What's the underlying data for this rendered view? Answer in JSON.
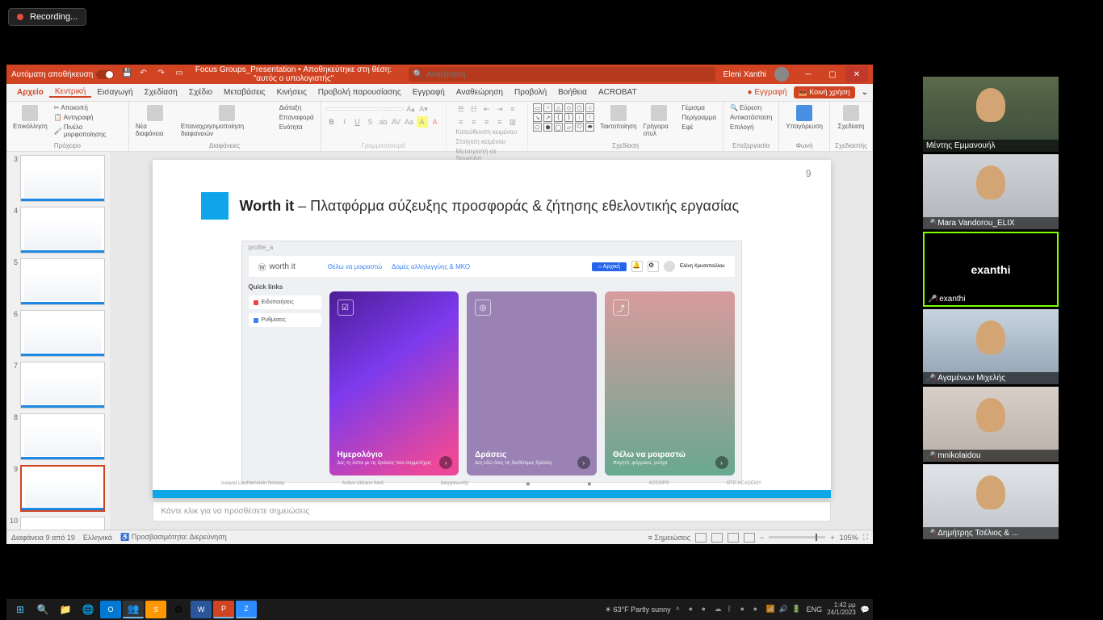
{
  "recording": {
    "label": "Recording..."
  },
  "titlebar": {
    "autosave": "Αυτόματη αποθήκευση",
    "filename": "Focus Groups_Presentation",
    "saved_location": "• Αποθηκεύτηκε στη θέση: \"αυτός ο υπολογιστής\"",
    "search_placeholder": "Αναζήτηση",
    "user": "Eleni Xanthi"
  },
  "menu": {
    "file": "Αρχείο",
    "home": "Κεντρική",
    "insert": "Εισαγωγή",
    "draw": "Σχεδίαση",
    "design": "Σχέδιο",
    "transitions": "Μεταβάσεις",
    "animations": "Κινήσεις",
    "slideshow": "Προβολή παρουσίασης",
    "record": "Εγγραφή",
    "review": "Αναθεώρηση",
    "view": "Προβολή",
    "help": "Βοήθεια",
    "acrobat": "ACROBAT",
    "record_btn": "Εγγραφή",
    "share": "Κοινή χρήση"
  },
  "ribbon": {
    "clipboard": {
      "label": "Πρόχειρο",
      "paste": "Επικόλληση",
      "cut": "Αποκοπή",
      "copy": "Αντιγραφή",
      "format_painter": "Πινέλο μορφοποίησης"
    },
    "slides": {
      "label": "Διαφάνειες",
      "new": "Νέα διαφάνεια",
      "reuse": "Επαναχρησιμοποίηση διαφανειών",
      "layout": "Διάταξη",
      "reset": "Επαναφορά",
      "section": "Ενότητα"
    },
    "font": {
      "label": "Γραμματοσειρά"
    },
    "paragraph": {
      "label": "Παράγραφος",
      "direction": "Κατεύθυνση κειμένου",
      "align": "Στοίχιση κειμένου",
      "smartart": "Μετατροπή σε SmartArt"
    },
    "drawing": {
      "label": "Σχεδίαση",
      "arrange": "Τακτοποίηση",
      "quick_styles": "Γρήγορα στυλ",
      "fill": "Γέμισμα",
      "outline": "Περίγραμμα",
      "effects": "Εφέ"
    },
    "editing": {
      "label": "Επεξεργασία",
      "find": "Εύρεση",
      "replace": "Αντικατάσταση",
      "select": "Επιλογή"
    },
    "voice": {
      "label": "Φωνή",
      "dictate": "Υπαγόρευση"
    },
    "designer": {
      "label": "Σχεδιαστής",
      "btn": "Σχεδίαση"
    }
  },
  "slides_panel": {
    "visible": [
      3,
      4,
      5,
      6,
      7,
      8,
      9,
      10
    ],
    "active": 9,
    "total": 19
  },
  "slide": {
    "number": "9",
    "title_bold": "Worth it",
    "title_rest": " – Πλατφόρμα σύζευξης προσφοράς & ζήτησης εθελοντικής εργασίας",
    "mockup": {
      "tab": "profile_a",
      "logo": "worth it",
      "nav1": "Θέλω να μοιραστώ",
      "nav2": "Δομές αλληλεγγύης & ΜΚΟ",
      "btn": "Αρχική",
      "user": "Ελένη Χρυσοπούλου",
      "quicklinks": "Quick links",
      "link1": "Ειδοποιήσεις",
      "link2": "Ρυθμίσεις",
      "card1": {
        "title": "Ημερολόγιο",
        "desc": "Δες τη λίστα με τις δράσεις που συμμετέχεις"
      },
      "card2": {
        "title": "Δράσεις",
        "desc": "Δες εδώ όλες τις διαθέσιμες δράσεις"
      },
      "card3": {
        "title": "Θέλω να μοιραστώ",
        "desc": "Φαγητό, φάρμακα, ρούχα"
      }
    },
    "footer_logos": [
      "Iceland Liechtenstein Norway",
      "Active citizens fund",
      "Διοργανωτής",
      "",
      "",
      "ACCOPS",
      "OTE ACADEMY"
    ]
  },
  "notes": {
    "placeholder": "Κάντε κλικ για να προσθέσετε σημειώσεις"
  },
  "statusbar": {
    "slide_info": "Διαφάνεια 9 από 19",
    "lang": "Ελληνικά",
    "accessibility": "Προσβασιμότητα: Διερεύνηση",
    "notes_btn": "Σημειώσεις",
    "zoom": "105%"
  },
  "taskbar": {
    "weather": "63°F  Partly sunny",
    "lang": "ENG",
    "time": "1:42 μμ",
    "date": "24/1/2023"
  },
  "participants": [
    {
      "name": "Μέντης Εμμανουήλ",
      "muted": false
    },
    {
      "name": "Mara Vandorou_ELIX",
      "muted": true
    },
    {
      "name": "exanthi",
      "center_name": "exanthi",
      "muted": true,
      "speaking": true,
      "black": true
    },
    {
      "name": "Αγαμένων Μιχελής",
      "muted": true
    },
    {
      "name": "mnikolaidou",
      "muted": true
    },
    {
      "name": "Δημήτρης Τσέλιος & ...",
      "muted": true
    }
  ]
}
